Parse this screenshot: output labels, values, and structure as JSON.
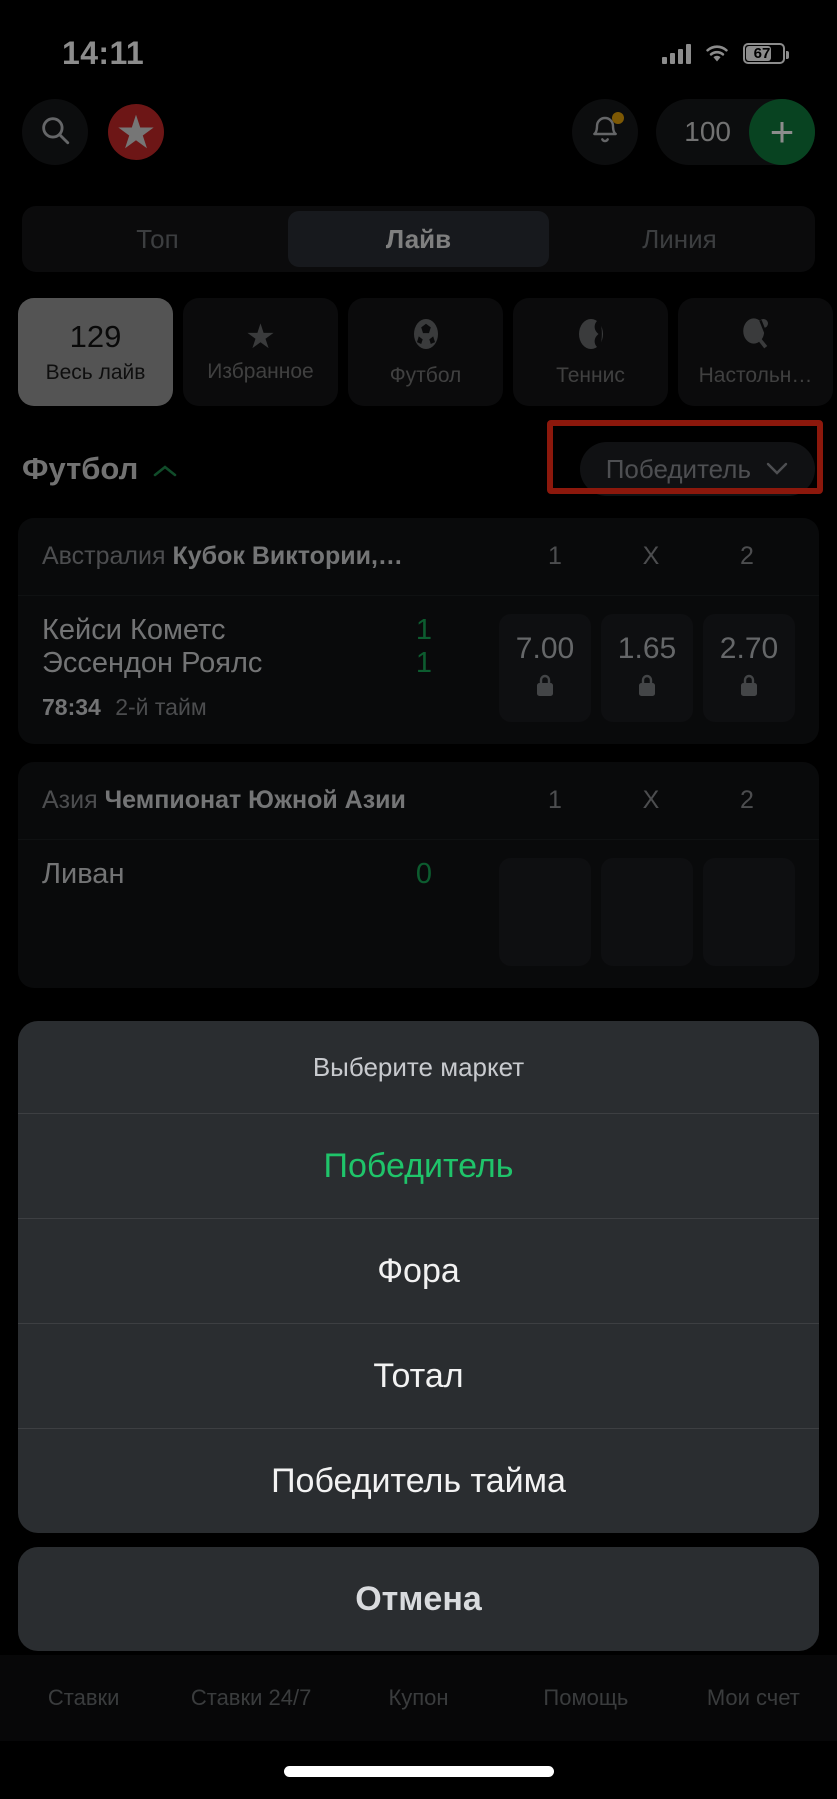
{
  "status_bar": {
    "time": "14:11",
    "battery_level": "67",
    "icons": {
      "cellular": "cellular-signal-icon",
      "wifi": "wifi-icon",
      "battery": "battery-icon"
    }
  },
  "app_bar": {
    "search_icon": "search-icon",
    "logo_icon": "app-logo-icon",
    "notifications_icon": "bell-icon",
    "balance": "100",
    "deposit_label": "+"
  },
  "segments": [
    {
      "label": "Топ",
      "active": false
    },
    {
      "label": "Лайв",
      "active": true
    },
    {
      "label": "Линия",
      "active": false
    }
  ],
  "sport_chips": [
    {
      "count": "129",
      "label": "Весь лайв",
      "icon": "",
      "active": true
    },
    {
      "count": "",
      "label": "Избранное",
      "icon": "star-icon",
      "active": false
    },
    {
      "count": "",
      "label": "Футбол",
      "icon": "soccer-ball-icon",
      "active": false
    },
    {
      "count": "",
      "label": "Теннис",
      "icon": "tennis-ball-icon",
      "active": false
    },
    {
      "count": "",
      "label": "Настольн…",
      "icon": "table-tennis-icon",
      "active": false
    }
  ],
  "section": {
    "title": "Футбол",
    "collapse_icon": "chevron-up-icon",
    "market_button": {
      "label": "Победитель",
      "chevron_icon": "chevron-down-icon"
    }
  },
  "odds_columns": [
    "1",
    "X",
    "2"
  ],
  "matches": [
    {
      "country": "Австралия",
      "league": "Кубок Виктории,…",
      "home": "Кейси Кометс",
      "away": "Эссендон Роялс",
      "home_score": "1",
      "away_score": "1",
      "clock": "78:34",
      "period": "2-й тайм",
      "odds": [
        {
          "value": "7.00",
          "locked": true,
          "lock_icon": "lock-icon"
        },
        {
          "value": "1.65",
          "locked": true,
          "lock_icon": "lock-icon"
        },
        {
          "value": "2.70",
          "locked": true,
          "lock_icon": "lock-icon"
        }
      ]
    },
    {
      "country": "Азия",
      "league": "Чемпионат Южной Азии",
      "home": "Ливан",
      "away": "",
      "home_score": "0",
      "away_score": "",
      "clock": "",
      "period": "",
      "odds": [
        {
          "value": "",
          "locked": false,
          "lock_icon": ""
        },
        {
          "value": "",
          "locked": false,
          "lock_icon": ""
        },
        {
          "value": "",
          "locked": false,
          "lock_icon": ""
        }
      ]
    }
  ],
  "action_sheet": {
    "title": "Выберите маркет",
    "options": [
      {
        "label": "Победитель",
        "selected": true
      },
      {
        "label": "Фора",
        "selected": false
      },
      {
        "label": "Тотал",
        "selected": false
      },
      {
        "label": "Победитель тайма",
        "selected": false
      }
    ],
    "cancel_label": "Отмена"
  },
  "bottom_nav": [
    {
      "label": "Ставки"
    },
    {
      "label": "Ставки 24/7"
    },
    {
      "label": "Купон"
    },
    {
      "label": "Помощь"
    },
    {
      "label": "Мои счет"
    }
  ],
  "colors": {
    "accent_green": "#1fc46a",
    "score_green": "#17a857",
    "highlight_red": "#ff2d16",
    "deposit_green": "#0f7a3d"
  }
}
